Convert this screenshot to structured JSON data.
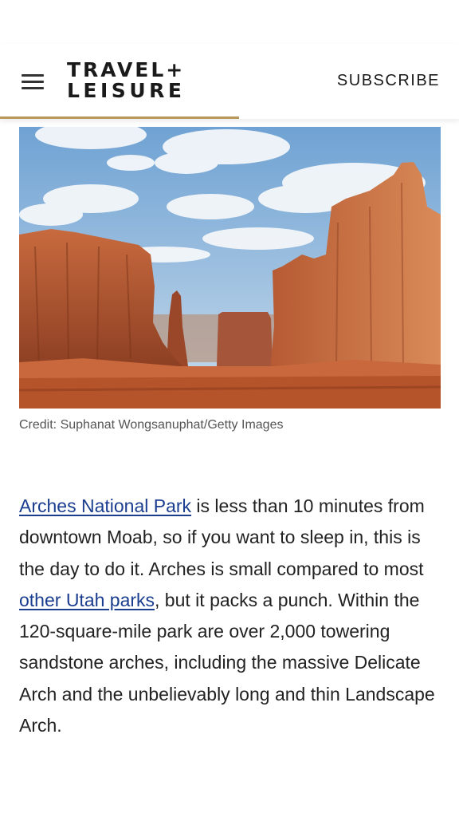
{
  "header": {
    "logo_line1": "TRAVEL+",
    "logo_line2": "LEISURE",
    "subscribe_label": "SUBSCRIBE",
    "menu_icon": "hamburger-menu-icon",
    "accent_color": "#b8985a"
  },
  "hero": {
    "credit": "Credit: Suphanat Wongsanuphat/Getty Images"
  },
  "article": {
    "link1": "Arches National Park",
    "text1": " is less than 10 minutes from downtown Moab, so if you want to sleep in, this is the day to do it. Arches is small compared to most ",
    "link2": "other Utah parks",
    "text2": ", but it packs a punch. Within the 120-square-mile park are over 2,000 towering sandstone arches, including the massive Delicate Arch and the unbelievably long and thin Landscape Arch.",
    "link_color": "#1a3d8f"
  }
}
